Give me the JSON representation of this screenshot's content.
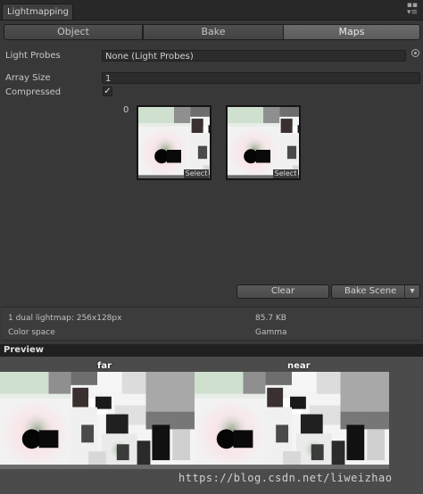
{
  "window": {
    "tab_title": "Lightmapping",
    "controls_icon": "window-menu-icon"
  },
  "toolbar": {
    "tabs": [
      "Object",
      "Bake",
      "Maps"
    ],
    "active_tab": "Maps"
  },
  "properties": {
    "light_probes_label": "Light Probes",
    "light_probes_value": "None (Light Probes)",
    "array_size_label": "Array Size",
    "array_size_value": "1",
    "compressed_label": "Compressed",
    "compressed_checked": true,
    "compressed_check_glyph": "✓"
  },
  "lightmaps": {
    "index_label": "0",
    "select_label": "Select"
  },
  "buttons": {
    "clear": "Clear",
    "bake_scene": "Bake Scene",
    "bake_dropdown": "▾"
  },
  "info": {
    "description": "1 dual lightmap: 256x128px",
    "size": "85.7 KB",
    "color_space_label": "Color space",
    "color_space_value": "Gamma"
  },
  "preview": {
    "header": "Preview",
    "far_label": "far",
    "near_label": "near"
  },
  "watermark": "https://blog.csdn.net/liweizhao",
  "colors": {
    "background": "#383838",
    "active_tab": "#5c5c5c",
    "preview_header": "#202020"
  }
}
